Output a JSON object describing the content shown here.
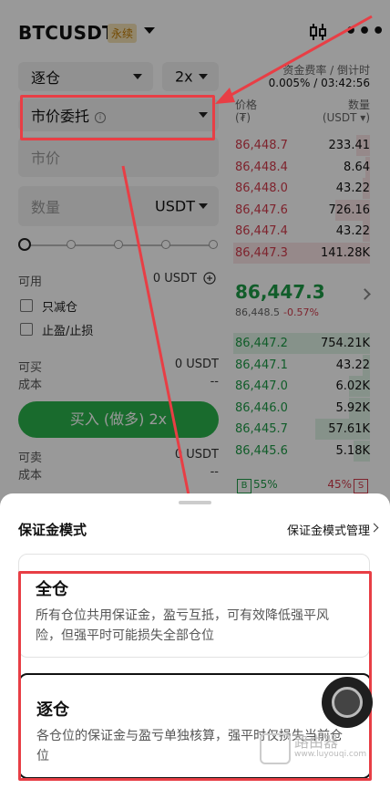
{
  "header": {
    "symbol": "BTCUSDT",
    "tag": "永续",
    "more": "•••"
  },
  "trade_form": {
    "margin_select": "逐仓",
    "leverage_select": "2x",
    "order_type": "市价委托",
    "price_field": "市价",
    "amount_placeholder": "数量",
    "amount_unit": "USDT",
    "available_label": "可用",
    "available_value": "0 USDT",
    "reduce_only": "只减仓",
    "tp_sl": "止盈/止损",
    "can_buy_label": "可买",
    "can_buy_value": "0 USDT",
    "cost_label": "成本",
    "cost_value": "--",
    "buy_button": "买入 (做多) 2x",
    "can_sell_label": "可卖",
    "can_sell_value": "0 USDT",
    "cost2_label": "成本",
    "cost2_value": "--"
  },
  "orderbook": {
    "funding_label": "资金费率 / 倒计时",
    "funding_value": "0.005% / 03:42:56",
    "price_header": "价格",
    "price_unit": "(₮)",
    "qty_header": "数量",
    "qty_unit": "(USDT ▾)",
    "asks": [
      {
        "price": "86,448.7",
        "qty": "233.41",
        "depth": 0.1
      },
      {
        "price": "86,448.4",
        "qty": "8.64",
        "depth": 0.03
      },
      {
        "price": "86,448.0",
        "qty": "43.22",
        "depth": 0.05
      },
      {
        "price": "86,447.6",
        "qty": "726.16",
        "depth": 0.25
      },
      {
        "price": "86,447.4",
        "qty": "43.22",
        "depth": 0.05
      },
      {
        "price": "86,447.3",
        "qty": "141.28K",
        "depth": 1.0
      }
    ],
    "last_price": "86,447.3",
    "mark_price": "86,448.5",
    "change": "-0.57%",
    "bids": [
      {
        "price": "86,447.2",
        "qty": "754.21K",
        "depth": 1.0
      },
      {
        "price": "86,447.1",
        "qty": "43.22",
        "depth": 0.05
      },
      {
        "price": "86,447.0",
        "qty": "6.02K",
        "depth": 0.15
      },
      {
        "price": "86,446.0",
        "qty": "5.92K",
        "depth": 0.15
      },
      {
        "price": "86,445.7",
        "qty": "57.61K",
        "depth": 0.4
      },
      {
        "price": "86,445.6",
        "qty": "5.18K",
        "depth": 0.12
      }
    ],
    "buy_ratio": "55%",
    "sell_ratio": "45%",
    "buy_letter": "B",
    "sell_letter": "S"
  },
  "sheet": {
    "title": "保证金模式",
    "manage_link": "保证金模式管理",
    "options": [
      {
        "name": "全仓",
        "desc": "所有仓位共用保证金，盈亏互抵，可有效降低强平风险，但强平时可能损失全部仓位"
      },
      {
        "name": "逐仓",
        "desc": "各仓位的保证金与盈亏单独核算，强平时仅损失当前仓位"
      }
    ]
  },
  "watermark": {
    "title": "路由器",
    "sub": "www.luyouqi.com"
  },
  "colors": {
    "buy": "#2bb24c",
    "sell": "#d33b4c",
    "annotation": "#e83e45"
  }
}
